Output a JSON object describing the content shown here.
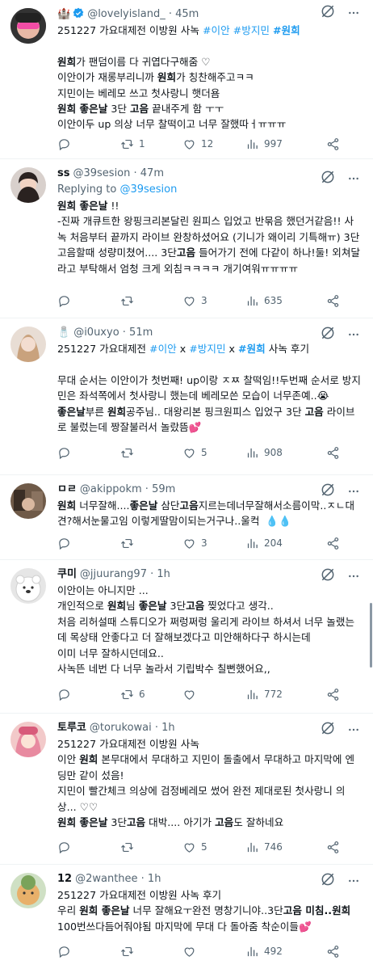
{
  "tweets": [
    {
      "name": "🏰",
      "handle": "@lovelyisland_ · 45m",
      "lines": [
        [
          {
            "t": "251227 가요대제전 이방원 사녹 "
          },
          {
            "t": "#이안 #방지민 ",
            "c": "tag"
          },
          {
            "t": "#원희",
            "c": "tag hl"
          }
        ],
        [
          {
            "t": " "
          }
        ],
        [
          {
            "t": "원희",
            "c": "hl"
          },
          {
            "t": "가 팬덤이름 다 귀엽다구해줌 ♡"
          }
        ],
        [
          {
            "t": "이안이가 재롱부리니까 "
          },
          {
            "t": "원희",
            "c": "hl"
          },
          {
            "t": "가 칭찬해주고ㅋㅋ"
          }
        ],
        [
          {
            "t": "지민이는 베레모 쓰고 첫사랑니 햇더욤"
          }
        ],
        [
          {
            "t": "원희 좋은날",
            "c": "hl"
          },
          {
            "t": " 3단 "
          },
          {
            "t": "고음",
            "c": "hl"
          },
          {
            "t": " 끝내주게 함 ㅜㅜ"
          }
        ],
        [
          {
            "t": "이안이두 up 의상 너무 찰떡이고 너무 잘했따ㅓㅠㅠㅠ"
          }
        ]
      ],
      "replies": "",
      "retweets": "1",
      "likes": "12",
      "views": "997"
    },
    {
      "name": "ss",
      "handle": "@39sesion · 47m",
      "reply_to_label": "Replying to ",
      "reply_to_handle": "@39sesion",
      "lines": [
        [
          {
            "t": "원희 좋은날",
            "c": "hl"
          },
          {
            "t": " !!"
          }
        ],
        [
          {
            "t": "-진짜 개큐트한 왕핑크리본달린 원피스 입었고 반묶음 했던거같음!! 사"
          }
        ],
        [
          {
            "t": "녹 처음부터 끝까지 라이브 완창하셨어요 (기니가 왜이리 기특해ㅠ) 3단"
          }
        ],
        [
          {
            "t": "고음할때 성량미쳤어.... 3단"
          },
          {
            "t": "고음",
            "c": "hl"
          },
          {
            "t": " 들어가기 전에 다같이 하나!둘! 외쳐달"
          }
        ],
        [
          {
            "t": "라고 부탁해서 엄청 크게 외침ㅋㅋㅋㅋ 개기여워ㅠㅠㅠㅠ"
          }
        ]
      ],
      "replies": "",
      "retweets": "",
      "likes": "3",
      "views": "635"
    },
    {
      "name": "🧂",
      "handle": "@i0uxyo · 51m",
      "lines": [
        [
          {
            "t": "251227 가요대제전 "
          },
          {
            "t": "#이안",
            "c": "tag"
          },
          {
            "t": " x "
          },
          {
            "t": "#방지민",
            "c": "tag"
          },
          {
            "t": " x "
          },
          {
            "t": "#원희",
            "c": "tag hl"
          },
          {
            "t": " 사녹 후기"
          }
        ],
        [
          {
            "t": " "
          }
        ],
        [
          {
            "t": "무대 순서는 이안이가 첫번째! up이랑 ㅈㅉ 찰떡임!!두번째 순서로 방지"
          }
        ],
        [
          {
            "t": "민은 좌석쪽에서 첫사랑니 했는데 베레모쓴 모습이 너무존예..😭"
          }
        ],
        [
          {
            "t": "좋은날",
            "c": "hl"
          },
          {
            "t": "부른 "
          },
          {
            "t": "원희",
            "c": "hl"
          },
          {
            "t": "공주님.. 대왕리본 핑크원피스 입었구 3단 "
          },
          {
            "t": "고음",
            "c": "hl"
          },
          {
            "t": " 라이브"
          }
        ],
        [
          {
            "t": "로 불렀는데 짱잘불러서 놀랐뜸💕"
          }
        ]
      ],
      "replies": "",
      "retweets": "",
      "likes": "5",
      "views": "908"
    },
    {
      "name": "ㅁㄹ",
      "handle": "@akippokm · 59m",
      "lines": [
        [
          {
            "t": "원희",
            "c": "hl"
          },
          {
            "t": " 너무잘해...."
          },
          {
            "t": "좋은날",
            "c": "hl"
          },
          {
            "t": " 삼단"
          },
          {
            "t": "고음",
            "c": "hl"
          },
          {
            "t": "지르는데너무잘해서소름이막..ㅈㄴ대"
          }
        ],
        [
          {
            "t": "견?해서눈물고임 이렇게딸맘이되는거구나..울컥  💧💧"
          }
        ]
      ],
      "replies": "",
      "retweets": "",
      "likes": "3",
      "views": "204"
    },
    {
      "name": "쿠미",
      "handle": "@jjuurang97 · 1h",
      "lines": [
        [
          {
            "t": "이안이는 아니지만 ..."
          }
        ],
        [
          {
            "t": "개인적으로 "
          },
          {
            "t": "원희",
            "c": "hl"
          },
          {
            "t": "님 "
          },
          {
            "t": "좋은날",
            "c": "hl"
          },
          {
            "t": " 3단"
          },
          {
            "t": "고음",
            "c": "hl"
          },
          {
            "t": " 찢었다고 생각.."
          }
        ],
        [
          {
            "t": "처음 리허설때 스튜디오가 쩌렁쩌렁 울리게 라이브 하셔서 너무 놀랬는"
          }
        ],
        [
          {
            "t": "데 목상태 안좋다고 더 잘해보겠다고 미안해하다구 하시는데"
          }
        ],
        [
          {
            "t": "이미 너무 잘하시던데요.."
          }
        ],
        [
          {
            "t": "사녹뜬 네번 다 너무 놀라서 기립박수 칠뻔했어요,,"
          }
        ]
      ],
      "replies": "",
      "retweets": "6",
      "likes": "",
      "views": "772"
    },
    {
      "name": "토루코",
      "handle": "@torukowai · 1h",
      "lines": [
        [
          {
            "t": "251227 가요대제전 이방원 사녹"
          }
        ],
        [
          {
            "t": "이안 "
          },
          {
            "t": "원희",
            "c": "hl"
          },
          {
            "t": " 본무대에서 무대하고 지민이 돌출에서 무대하고 마지막에 엔"
          }
        ],
        [
          {
            "t": "딩만 같이 섰음!"
          }
        ],
        [
          {
            "t": "지민이 빨간체크 의상에 검정베레모 썼어 완전 제대로된 첫사랑니 의"
          }
        ],
        [
          {
            "t": "상... ♡♡"
          }
        ],
        [
          {
            "t": "원희 좋은날",
            "c": "hl"
          },
          {
            "t": " 3단"
          },
          {
            "t": "고음",
            "c": "hl"
          },
          {
            "t": " 대박.... 아기가 "
          },
          {
            "t": "고음",
            "c": "hl"
          },
          {
            "t": "도 잘하네요"
          }
        ]
      ],
      "replies": "",
      "retweets": "",
      "likes": "5",
      "views": "746"
    },
    {
      "name": "12",
      "handle": "@2wanthee · 1h",
      "lines": [
        [
          {
            "t": "251227 가요대제전 이방원 사녹 후기"
          }
        ],
        [
          {
            "t": "우리 "
          },
          {
            "t": "원희 좋은날",
            "c": "hl"
          },
          {
            "t": " 너무 잘해요ㅜ완전 명창기니야..3단"
          },
          {
            "t": "고음",
            "c": "hl"
          },
          {
            "t": " 미침..원희",
            "c": "hl"
          }
        ],
        [
          {
            "t": "100번쓰다듬어줘야됨 마지막에 무대 다 돌아줌 착순이들💕"
          }
        ]
      ],
      "replies": "",
      "retweets": "",
      "likes": "",
      "views": "492"
    }
  ],
  "colors": {
    "accent": "#1d9bf0",
    "muted": "#536471",
    "verified": "#1d9bf0"
  }
}
